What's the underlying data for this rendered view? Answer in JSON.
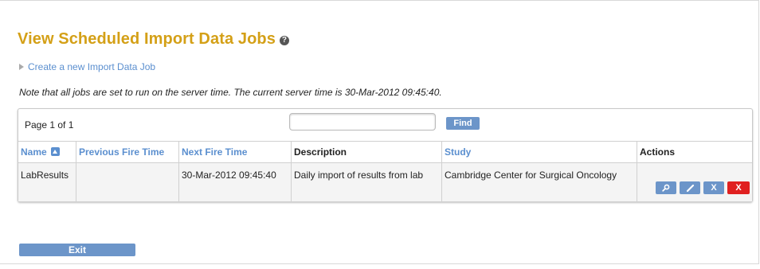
{
  "page": {
    "title": "View Scheduled Import Data Jobs",
    "help_icon": "?",
    "create_link": "Create a new Import Data Job",
    "note": "Note that all jobs are set to run on the server time. The current server time is 30-Mar-2012 09:45:40."
  },
  "table_panel": {
    "page_info": "Page 1 of 1",
    "search_value": "",
    "search_placeholder": "",
    "find_label": "Find",
    "columns": [
      "Name",
      "Previous Fire Time",
      "Next Fire Time",
      "Description",
      "Study",
      "Actions"
    ],
    "rows": [
      {
        "name": "LabResults",
        "previous_fire_time": "",
        "next_fire_time": "30-Mar-2012 09:45:40",
        "description": "Daily import of results from lab",
        "study": "Cambridge Center for Surgical Oncology"
      }
    ],
    "action_icons": [
      "magnifier-icon",
      "pencil-icon",
      "close-x-icon",
      "delete-x-icon"
    ],
    "action_glyphs": {
      "delete": "X",
      "remove": "X"
    }
  },
  "footer": {
    "exit_label": "Exit"
  },
  "colors": {
    "title": "#d4a017",
    "link": "#5b8fcf",
    "button": "#6c95c9",
    "delete_button": "#e02020"
  }
}
